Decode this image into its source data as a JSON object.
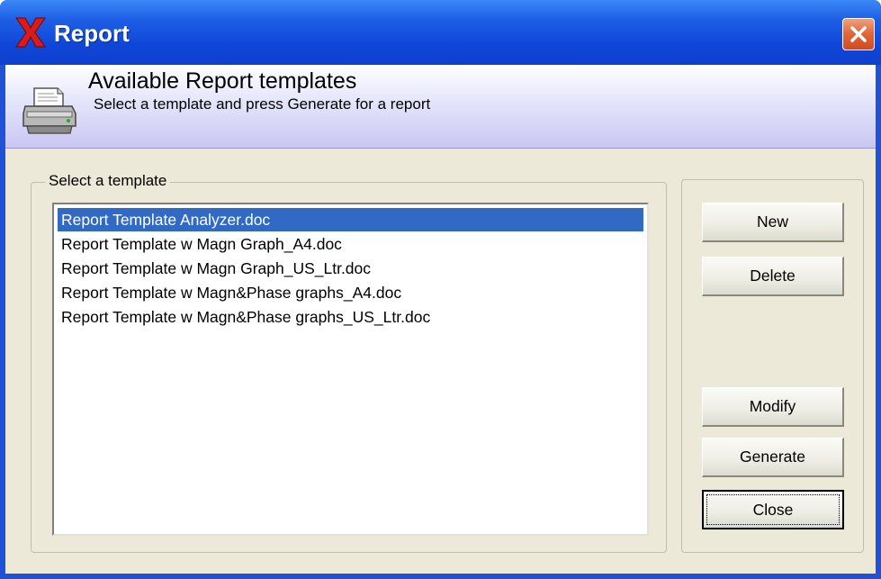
{
  "window": {
    "title": "Report",
    "icons": {
      "app": "x-logo-icon",
      "close": "close-icon"
    }
  },
  "header": {
    "title": "Available Report templates",
    "subtitle": "Select a template and press Generate for a report",
    "icon": "printer-icon"
  },
  "templates": {
    "group_label": "Select a template",
    "items": [
      "Report Template Analyzer.doc",
      "Report Template w Magn Graph_A4.doc",
      "Report Template w Magn Graph_US_Ltr.doc",
      "Report Template w Magn&Phase graphs_A4.doc",
      "Report Template w Magn&Phase graphs_US_Ltr.doc"
    ],
    "selected_index": 0
  },
  "buttons": {
    "new": "New",
    "delete": "Delete",
    "modify": "Modify",
    "generate": "Generate",
    "close": "Close"
  },
  "colors": {
    "titlebar": "#0e40cc",
    "selection": "#316ac5",
    "dialog_face": "#ece9d8",
    "close_button": "#e06a3c"
  }
}
